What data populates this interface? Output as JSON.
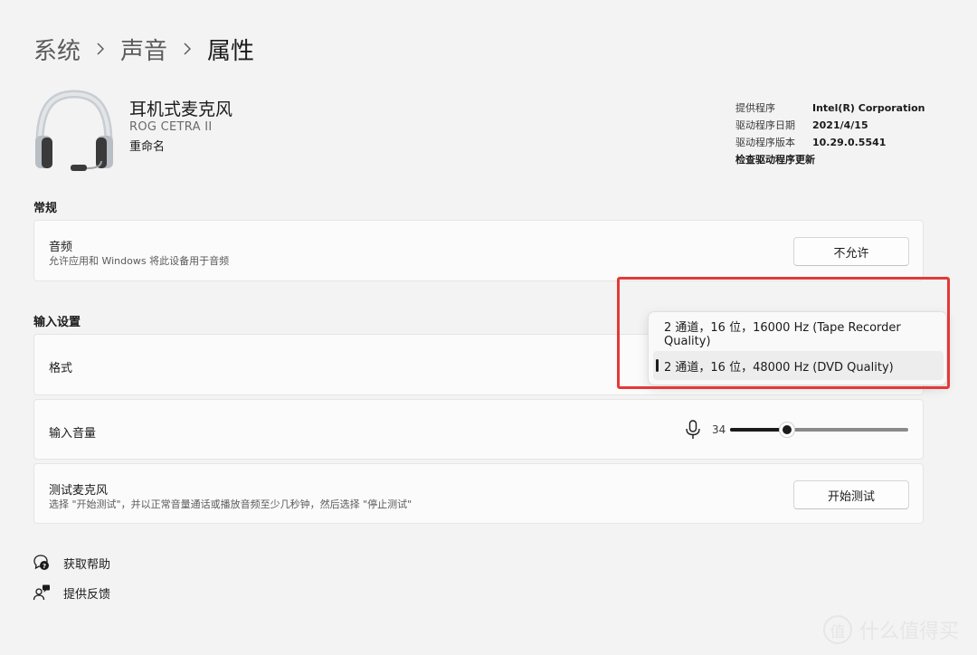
{
  "breadcrumb": {
    "items": [
      "系统",
      "声音"
    ],
    "current": "属性"
  },
  "device": {
    "icon": "headset-icon",
    "title": "耳机式麦克风",
    "model": "ROG CETRA II",
    "rename_label": "重命名"
  },
  "driver": {
    "provider_label": "提供程序",
    "provider_value": "Intel(R) Corporation",
    "date_label": "驱动程序日期",
    "date_value": "2021/4/15",
    "version_label": "驱动程序版本",
    "version_value": "10.29.0.5541",
    "update_link": "检查驱动程序更新"
  },
  "general": {
    "section_label": "常规",
    "audio": {
      "title": "音频",
      "description": "允许应用和 Windows 将此设备用于音频",
      "button_label": "不允许"
    }
  },
  "input_settings": {
    "section_label": "输入设置",
    "format": {
      "title": "格式"
    },
    "volume": {
      "title": "输入音量",
      "icon": "microphone-icon",
      "value": "34",
      "level": 34
    },
    "test": {
      "title": "测试麦克风",
      "description": "选择 \"开始测试\"，并以正常音量通话或播放音频至少几秒钟，然后选择 \"停止测试\"",
      "button_label": "开始测试"
    }
  },
  "format_dropdown": {
    "options": [
      "2 通道，16 位，16000 Hz (Tape Recorder Quality)",
      "2 通道，16 位，48000 Hz (DVD Quality)"
    ],
    "selected_index": 1,
    "annotation_color": "#e53935"
  },
  "footer": {
    "help_label": "获取帮助",
    "help_icon": "help-chat-icon",
    "feedback_label": "提供反馈",
    "feedback_icon": "feedback-icon"
  },
  "watermark": {
    "symbol": "值",
    "text": "什么值得买"
  },
  "colors": {
    "background": "#f3f3f3",
    "card": "#fbfbfb",
    "accent": "#1b1b1b",
    "annotation": "#e53935"
  }
}
